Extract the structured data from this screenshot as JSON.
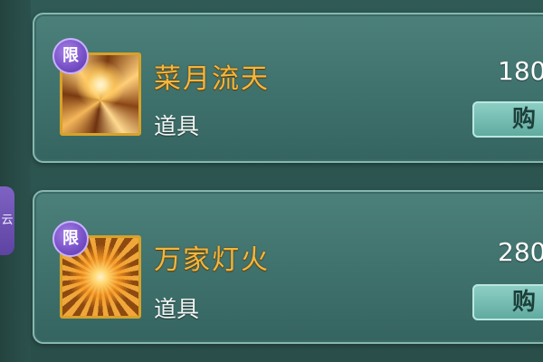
{
  "side_tab": {
    "label": "云"
  },
  "shop": {
    "items": [
      {
        "badge": "限",
        "icon": "glowing-blossom-icon",
        "name": "菜月流天",
        "type": "道具",
        "price": "180",
        "buy_label": "购"
      },
      {
        "badge": "限",
        "icon": "lantern-fire-icon",
        "name": "万家灯火",
        "type": "道具",
        "price": "280",
        "buy_label": "购"
      }
    ]
  },
  "colors": {
    "background": "#2f5a55",
    "card": "#3f716c",
    "name_gold": "#f3b63e",
    "badge_purple": "#7a52c9",
    "button": "#6fb9af"
  }
}
